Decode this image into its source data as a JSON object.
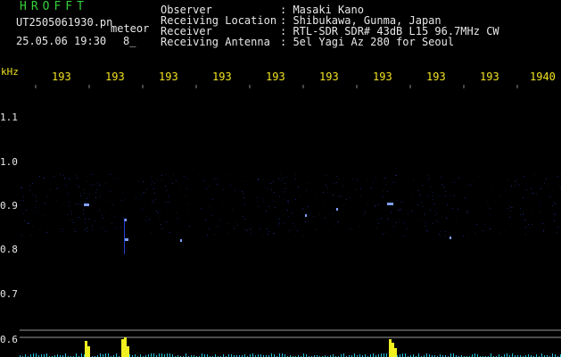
{
  "header": {
    "title": "HROFFT",
    "filename": "UT2505061930.pn",
    "detection_label": "meteor",
    "datetime": "25.05.06 19:30",
    "count": "8_"
  },
  "info": [
    {
      "label": "Observer",
      "value": ": Masaki Kano"
    },
    {
      "label": "Receiving Location",
      "value": ": Shibukawa, Gunma, Japan"
    },
    {
      "label": "Receiver",
      "value": ": RTL-SDR SDR# 43dB L15 96.7MHz CW"
    },
    {
      "label": "Receiving Antenna",
      "value": ": 5el Yagi Az 280 for Seoul"
    }
  ],
  "axis": {
    "unit": "kHz",
    "y_ticks": [
      "1.1",
      "1.0",
      "0.9",
      "0.8",
      "0.7",
      "0.6"
    ],
    "x_ticks": [
      "193",
      "193",
      "193",
      "193",
      "193",
      "193",
      "193",
      "193",
      "193",
      "1940"
    ]
  },
  "colors": {
    "text_green": "#35d03a",
    "text_yellow": "#f0e020",
    "signal_blue": "#3050ff",
    "trace_yellow": "#f0f020",
    "trace_cyan": "#20c0e0"
  }
}
